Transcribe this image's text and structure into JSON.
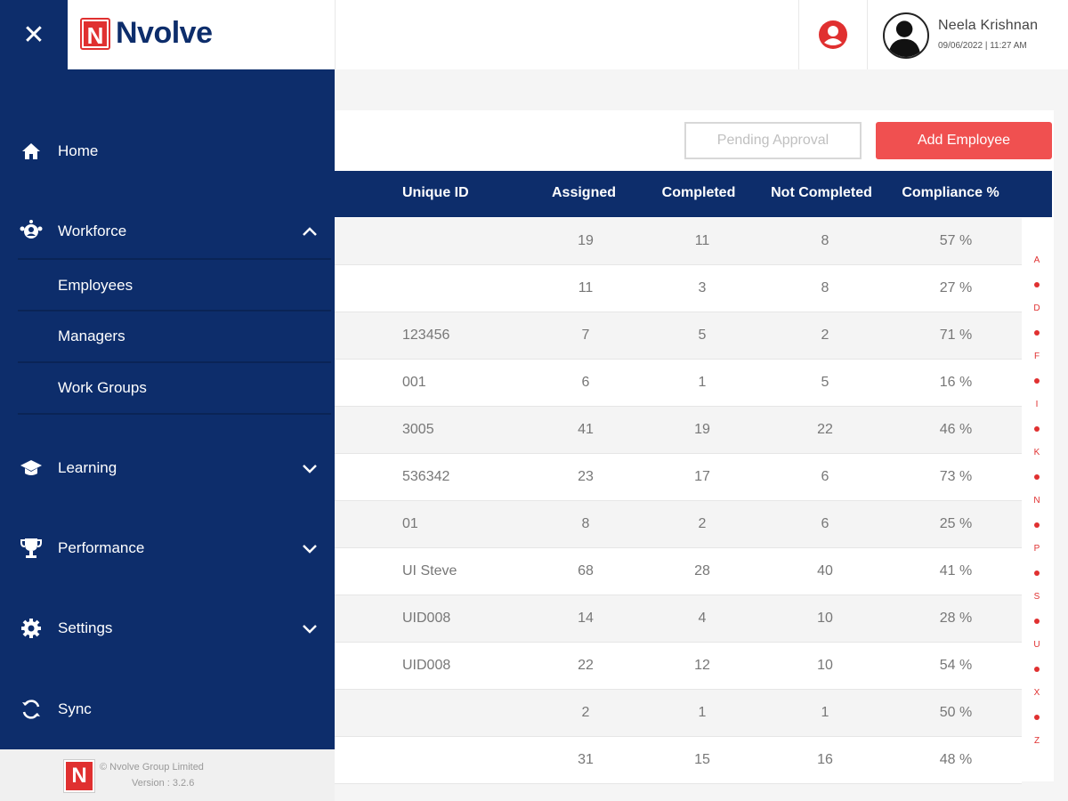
{
  "app": {
    "brand": "Nvolve",
    "logo_letter": "N"
  },
  "user": {
    "name": "Neela Krishnan",
    "timestamp": "09/06/2022 | 11:27 AM"
  },
  "sidebar": {
    "items": [
      {
        "label": "Home",
        "icon": "home-icon"
      },
      {
        "label": "Workforce",
        "icon": "workforce-icon",
        "expanded": true,
        "children": [
          "Employees",
          "Managers",
          "Work Groups"
        ]
      },
      {
        "label": "Learning",
        "icon": "graduation-cap-icon"
      },
      {
        "label": "Performance",
        "icon": "trophy-icon"
      },
      {
        "label": "Settings",
        "icon": "gear-icon"
      },
      {
        "label": "Sync",
        "icon": "sync-icon"
      }
    ],
    "footer": {
      "copyright": "© Nvolve Group Limited",
      "version": "Version : 3.2.6"
    }
  },
  "actions": {
    "pending": "Pending Approval",
    "add": "Add Employee"
  },
  "table": {
    "columns": [
      "Unique ID",
      "Assigned",
      "Completed",
      "Not Completed",
      "Compliance %"
    ],
    "rows": [
      [
        "",
        "19",
        "11",
        "8",
        "57 %"
      ],
      [
        "",
        "11",
        "3",
        "8",
        "27 %"
      ],
      [
        "123456",
        "7",
        "5",
        "2",
        "71 %"
      ],
      [
        "001",
        "6",
        "1",
        "5",
        "16 %"
      ],
      [
        "3005",
        "41",
        "19",
        "22",
        "46 %"
      ],
      [
        "536342",
        "23",
        "17",
        "6",
        "73 %"
      ],
      [
        "01",
        "8",
        "2",
        "6",
        "25 %"
      ],
      [
        "UI Steve",
        "68",
        "28",
        "40",
        "41 %"
      ],
      [
        "UID008",
        "14",
        "4",
        "10",
        "28 %"
      ],
      [
        "UID008",
        "22",
        "12",
        "10",
        "54 %"
      ],
      [
        "",
        "2",
        "1",
        "1",
        "50 %"
      ],
      [
        "",
        "31",
        "15",
        "16",
        "48 %"
      ]
    ]
  },
  "alpha_index": [
    "A",
    "D",
    "F",
    "I",
    "K",
    "N",
    "P",
    "S",
    "U",
    "X",
    "Z"
  ],
  "colors": {
    "navy": "#0d2d6b",
    "accent": "#f05050",
    "brand_red": "#e03030"
  }
}
